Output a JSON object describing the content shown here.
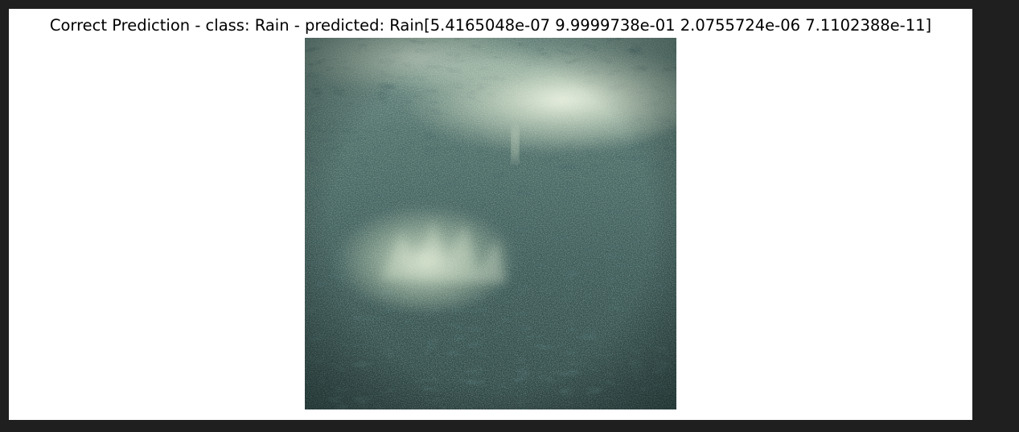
{
  "figure": {
    "title": "Correct Prediction - class: Rain - predicted: Rain[5.4165048e-07 9.9999738e-01 2.0755724e-06 7.1102388e-11]",
    "background_color": "#ffffff",
    "image": {
      "subject": "rain-splashing-water-surface",
      "palette": [
        "#2f4a48",
        "#4f6e68",
        "#7d9c90",
        "#c9dcc0",
        "#e9f2de"
      ]
    }
  },
  "window": {
    "background_color": "#1f1f1f"
  }
}
